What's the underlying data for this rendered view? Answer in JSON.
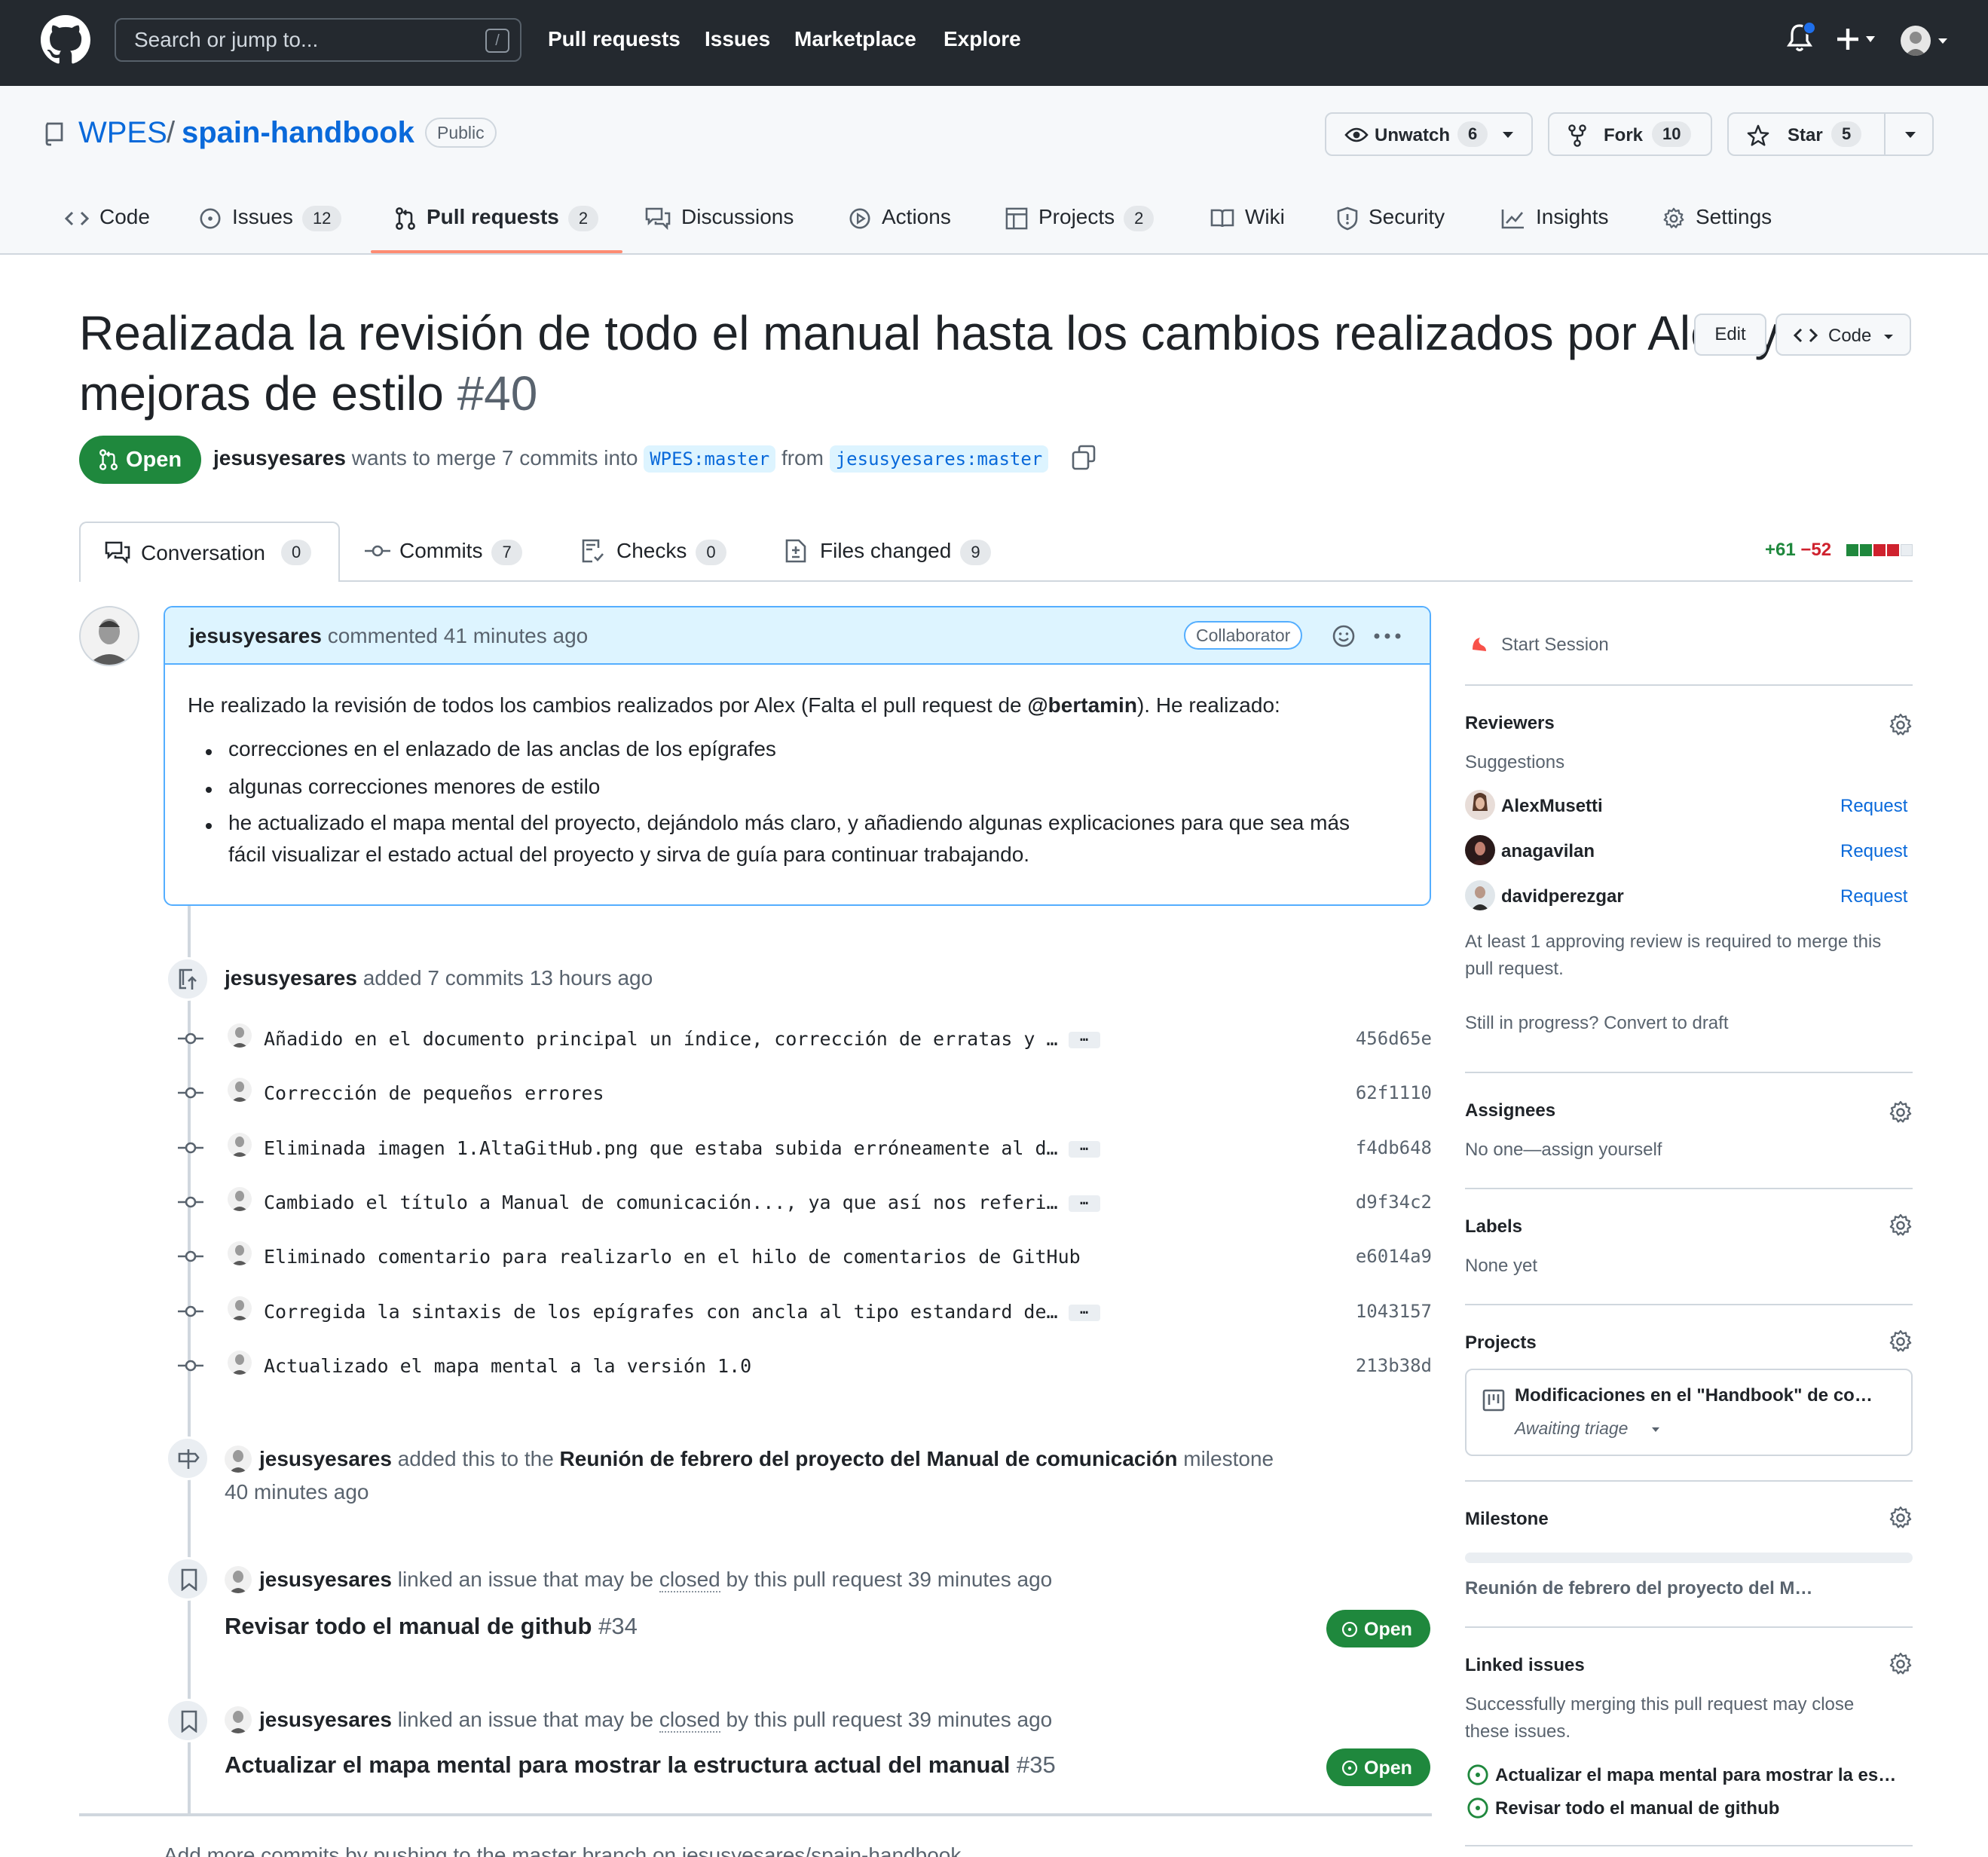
{
  "topbar": {
    "search_placeholder": "Search or jump to...",
    "slash_key": "/",
    "nav": [
      "Pull requests",
      "Issues",
      "Marketplace",
      "Explore"
    ]
  },
  "repo": {
    "owner": "WPES",
    "separator": "/",
    "name": "spain-handbook",
    "visibility": "Public",
    "unwatch_label": "Unwatch",
    "unwatch_count": "6",
    "fork_label": "Fork",
    "fork_count": "10",
    "star_label": "Star",
    "star_count": "5"
  },
  "repo_tabs": [
    {
      "label": "Code",
      "count": ""
    },
    {
      "label": "Issues",
      "count": "12"
    },
    {
      "label": "Pull requests",
      "count": "2"
    },
    {
      "label": "Discussions",
      "count": ""
    },
    {
      "label": "Actions",
      "count": ""
    },
    {
      "label": "Projects",
      "count": "2"
    },
    {
      "label": "Wiki",
      "count": ""
    },
    {
      "label": "Security",
      "count": ""
    },
    {
      "label": "Insights",
      "count": ""
    },
    {
      "label": "Settings",
      "count": ""
    }
  ],
  "pr": {
    "title_line1": "Realizada la revisión de todo el manual hasta los cambios realizados por Alex y",
    "title_line2": "mejoras de estilo",
    "number": "#40",
    "edit_label": "Edit",
    "code_label": "Code",
    "state": "Open",
    "author": "jesusyesares",
    "merge_text": "wants to merge 7 commits into",
    "base_branch": "WPES:master",
    "from_text": "from",
    "head_branch": "jesusyesares:master"
  },
  "pr_tabs": [
    {
      "label": "Conversation",
      "count": "0"
    },
    {
      "label": "Commits",
      "count": "7"
    },
    {
      "label": "Checks",
      "count": "0"
    },
    {
      "label": "Files changed",
      "count": "9"
    }
  ],
  "diffstat": {
    "additions": "+61",
    "deletions": "−52",
    "colors": [
      "#1f883d",
      "#1f883d",
      "#cf222e",
      "#cf222e",
      "#eaeef2"
    ]
  },
  "comment": {
    "author": "jesusyesares",
    "meta": "commented 41 minutes ago",
    "role": "Collaborator",
    "intro_before": "He realizado la revisión de todos los cambios realizados por Alex (Falta el pull request de ",
    "mention": "@bertamin",
    "intro_after": "). He realizado:",
    "bullets": [
      "correcciones en el enlazado de las anclas de los epígrafes",
      "algunas correcciones menores de estilo",
      "he actualizado el mapa mental del proyecto, dejándolo más claro, y añadiendo algunas explicaciones para que sea más",
      "fácil visualizar el estado actual del proyecto y sirva de guía para continuar trabajando."
    ]
  },
  "commits_event": {
    "author": "jesusyesares",
    "text": "added 7 commits 13 hours ago"
  },
  "commits": [
    {
      "message": "Añadido en el documento principal un índice, corrección de erratas y …",
      "more": "…",
      "sha": "456d65e"
    },
    {
      "message": "Corrección de pequeños errores",
      "more": "",
      "sha": "62f1110"
    },
    {
      "message": "Eliminada imagen 1.AltaGitHub.png que estaba subida erróneamente al d…",
      "more": "…",
      "sha": "f4db648"
    },
    {
      "message": "Cambiado el título a Manual de comunicación..., ya que así nos referi…",
      "more": "…",
      "sha": "d9f34c2"
    },
    {
      "message": "Eliminado comentario para realizarlo en el hilo de comentarios de GitHub",
      "more": "",
      "sha": "e6014a9"
    },
    {
      "message": "Corregida la sintaxis de los epígrafes con ancla al tipo estandard de…",
      "more": "…",
      "sha": "1043157"
    },
    {
      "message": "Actualizado el mapa mental a la versión 1.0",
      "more": "",
      "sha": "213b38d"
    }
  ],
  "milestone_event": {
    "author": "jesusyesares",
    "text_before": "added this to the",
    "milestone": "Reunión de febrero del proyecto del Manual de comunicación",
    "text_after": "milestone",
    "time": "40 minutes ago"
  },
  "linked_events": [
    {
      "author": "jesusyesares",
      "text_before": "linked an issue that may be",
      "closed_word": "closed",
      "text_after": "by this pull request 39 minutes ago",
      "issue_title": "Revisar todo el manual de github",
      "issue_number": "#34",
      "state": "Open"
    },
    {
      "author": "jesusyesares",
      "text_before": "linked an issue that may be",
      "closed_word": "closed",
      "text_after": "by this pull request 39 minutes ago",
      "issue_title": "Actualizar el mapa mental para mostrar la estructura actual del manual",
      "issue_number": "#35",
      "state": "Open"
    }
  ],
  "footer_hint": "Add more commits by pushing to the master branch on jesusyesares/spain-handbook.",
  "sidebar": {
    "start_session": "Start Session",
    "reviewers_title": "Reviewers",
    "suggestions": "Suggestions",
    "reviewers": [
      {
        "name": "AlexMusetti",
        "action": "Request"
      },
      {
        "name": "anagavilan",
        "action": "Request"
      },
      {
        "name": "davidperezgar",
        "action": "Request"
      }
    ],
    "review_note_1": "At least 1 approving review is required to merge this",
    "review_note_2": "pull request.",
    "draft_note": "Still in progress? Convert to draft",
    "assignees_title": "Assignees",
    "assignees_value": "No one—assign yourself",
    "labels_title": "Labels",
    "labels_value": "None yet",
    "projects_title": "Projects",
    "project_name": "Modificaciones en el \"Handbook\" de co…",
    "project_status": "Awaiting triage",
    "milestone_title": "Milestone",
    "milestone_value": "Reunión de febrero del proyecto del M…",
    "linked_title": "Linked issues",
    "linked_note_1": "Successfully merging this pull request may close",
    "linked_note_2": "these issues.",
    "linked_issues": [
      "Actualizar el mapa mental para mostrar la es…",
      "Revisar todo el manual de github"
    ]
  },
  "colors": {
    "header_bg": "#24292f",
    "accent_link": "#0969da",
    "open_green": "#1f883d",
    "active_tab_underline": "#fd8c73",
    "comment_head_bg": "#ddf4ff"
  }
}
